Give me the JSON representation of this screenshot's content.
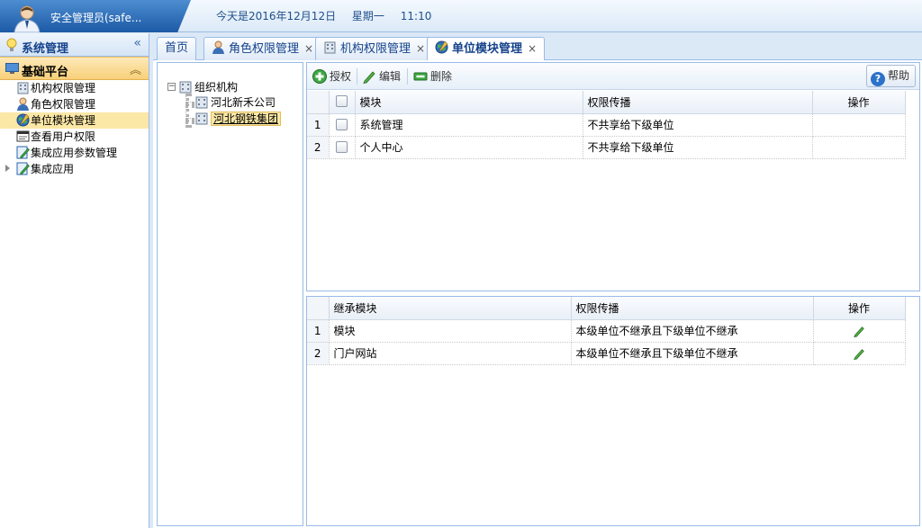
{
  "header": {
    "user_name": "安全管理员(safe...",
    "date_text": "今天是2016年12月12日",
    "weekday": "星期一",
    "time": "11:10"
  },
  "sidebar": {
    "system_title": "系统管理",
    "collapse_glyph": "«",
    "platform_title": "基础平台",
    "platform_collapse_glyph": "︽",
    "items": [
      {
        "label": "机构权限管理",
        "icon": "building-icon"
      },
      {
        "label": "角色权限管理",
        "icon": "user-icon"
      },
      {
        "label": "单位模块管理",
        "icon": "globe-icon",
        "selected": true
      },
      {
        "label": "查看用户权限",
        "icon": "window-icon"
      },
      {
        "label": "集成应用参数管理",
        "icon": "edit-doc-icon"
      },
      {
        "label": "集成应用",
        "icon": "edit-doc-icon",
        "expandable": true
      }
    ]
  },
  "tabs": [
    {
      "label": "首页",
      "closable": false
    },
    {
      "label": "角色权限管理",
      "closable": true,
      "icon": "user-icon"
    },
    {
      "label": "机构权限管理",
      "closable": true,
      "icon": "building-icon"
    },
    {
      "label": "单位模块管理",
      "closable": true,
      "icon": "globe-icon",
      "active": true
    }
  ],
  "tab_close_glyph": "×",
  "tree": {
    "root": "组织机构",
    "toggle_glyph": "−",
    "children": [
      "河北新禾公司",
      "河北钢铁集团"
    ]
  },
  "toolbar": {
    "authorize": "授权",
    "edit": "编辑",
    "delete": "删除",
    "help": "帮助",
    "help_glyph": "?"
  },
  "top_grid": {
    "headers": {
      "module": "模块",
      "propagation": "权限传播",
      "action": "操作"
    },
    "rows": [
      {
        "index": "1",
        "module": "系统管理",
        "propagation": "不共享给下级单位"
      },
      {
        "index": "2",
        "module": "个人中心",
        "propagation": "不共享给下级单位"
      }
    ]
  },
  "bottom_grid": {
    "headers": {
      "module": "继承模块",
      "propagation": "权限传播",
      "action": "操作"
    },
    "rows": [
      {
        "index": "1",
        "module": "模块",
        "propagation": "本级单位不继承且下级单位不继承"
      },
      {
        "index": "2",
        "module": "门户网站",
        "propagation": "本级单位不继承且下级单位不继承"
      }
    ]
  },
  "colors": {
    "accent": "#15428b",
    "header_blue": "#1c5aa6",
    "selected_row": "#fbe7a6"
  }
}
